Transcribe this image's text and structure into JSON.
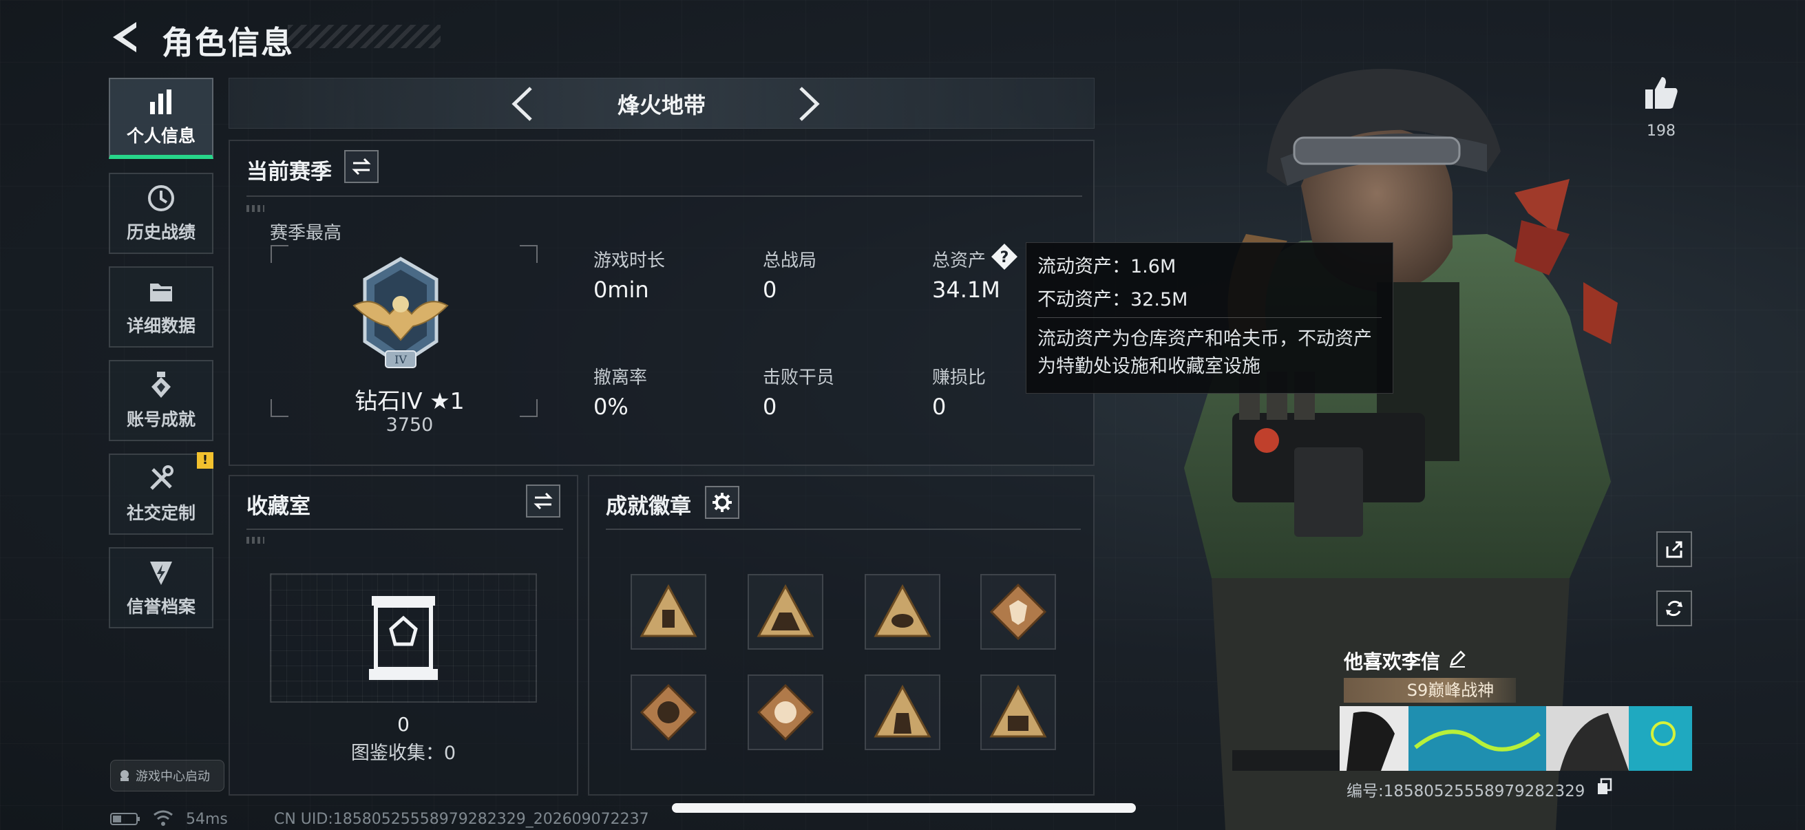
{
  "header": {
    "title": "角色信息"
  },
  "nav": {
    "items": [
      {
        "label": "个人信息",
        "icon": "bar-chart-icon",
        "active": true
      },
      {
        "label": "历史战绩",
        "icon": "history-clock-icon"
      },
      {
        "label": "详细数据",
        "icon": "folder-icon"
      },
      {
        "label": "账号成就",
        "icon": "achievement-medal-icon"
      },
      {
        "label": "社交定制",
        "icon": "tools-icon",
        "badge": "!"
      },
      {
        "label": "信誉档案",
        "icon": "shield-lightning-icon"
      }
    ],
    "game_center": "游戏中心启动"
  },
  "mode": {
    "title": "烽火地带"
  },
  "season": {
    "title": "当前赛季",
    "best_label": "赛季最高",
    "rank_name": "钻石IV ★1",
    "rank_score": "3750",
    "stats": [
      {
        "label": "游戏时长",
        "value": "0min"
      },
      {
        "label": "总战局",
        "value": "0"
      },
      {
        "label": "总资产",
        "value": "34.1M"
      },
      {
        "label": "撤离率",
        "value": "0%"
      },
      {
        "label": "击败干员",
        "value": "0"
      },
      {
        "label": "赚损比",
        "value": "0"
      }
    ]
  },
  "tooltip": {
    "liquid": "流动资产：1.6M",
    "fixed": "不动资产：32.5M",
    "desc": "流动资产为仓库资产和哈夫币，不动资产为特勤处设施和收藏室设施"
  },
  "collection": {
    "title": "收藏室",
    "count": "0",
    "catalog": "图鉴收集：0"
  },
  "achievements": {
    "title": "成就徽章",
    "colors": {
      "gold": "#c9a56a",
      "bronze": "#b07a4a",
      "dark": "#3a2a1c"
    }
  },
  "profile": {
    "like_count": "198",
    "player_name": "他喜欢李信",
    "title_tag": "S9巅峰战神",
    "uid_line": "编号:18580525558979282329"
  },
  "status_bar": {
    "ping": "54ms",
    "uid": "CN UID:18580525558979282329_202609072237"
  },
  "colors": {
    "accent": "#27d68a",
    "warning": "#f2c12e"
  }
}
